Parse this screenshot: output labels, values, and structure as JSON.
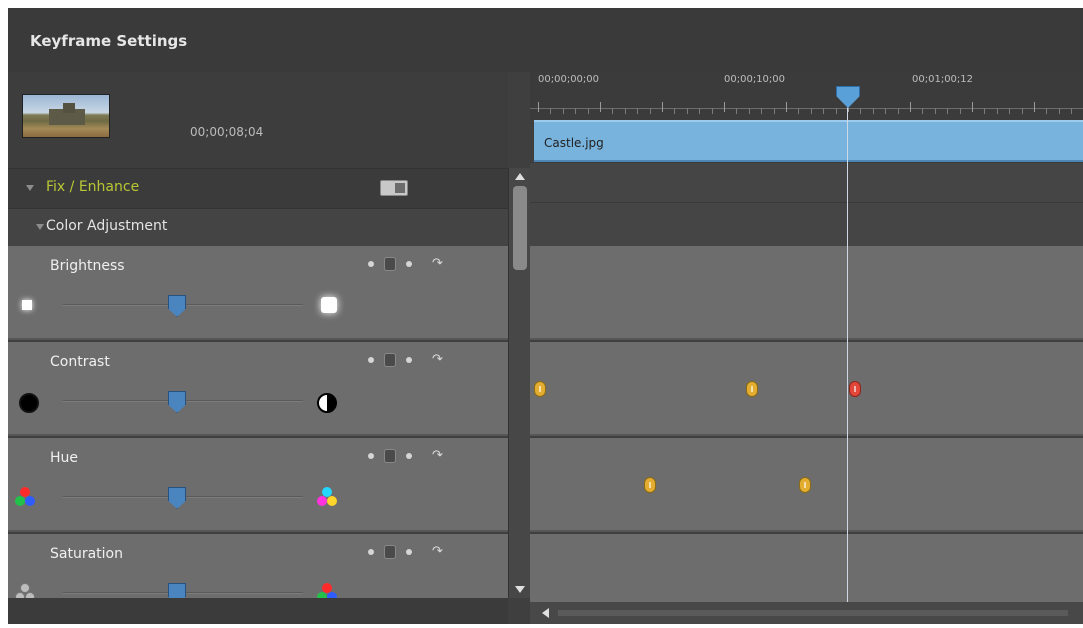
{
  "window": {
    "title": "Keyframe Settings"
  },
  "clip": {
    "time": "00;00;08;04",
    "name": "Castle.jpg"
  },
  "sections": {
    "fix_enhance": "Fix / Enhance",
    "color_adjustment": "Color Adjustment"
  },
  "params": [
    {
      "label": "Brightness",
      "value": 0.5
    },
    {
      "label": "Contrast",
      "value": 0.5
    },
    {
      "label": "Hue",
      "value": 0.5
    },
    {
      "label": "Saturation",
      "value": 0.5
    }
  ],
  "ruler": {
    "ticks": [
      "00;00;00;00",
      "00;00;10;00",
      "00;01;00;12"
    ]
  },
  "icons": {
    "section_expand": "triangle-down-icon",
    "toggle": "toggle-icon",
    "undo": "undo-icon",
    "rgb_colors": [
      "#ff2a2a",
      "#22c24a",
      "#2f5cff"
    ],
    "rgb_colors_high": [
      "#ff2a2a",
      "#22d8ff",
      "#ff33dd",
      "#ffd52a"
    ]
  },
  "colors": {
    "accent_green": "#b9c734",
    "clip_blue": "#78b3dd",
    "keyframe_gold": "#e3ad31",
    "keyframe_active_red": "#e2473a",
    "slider_blue": "#4a85c0"
  }
}
